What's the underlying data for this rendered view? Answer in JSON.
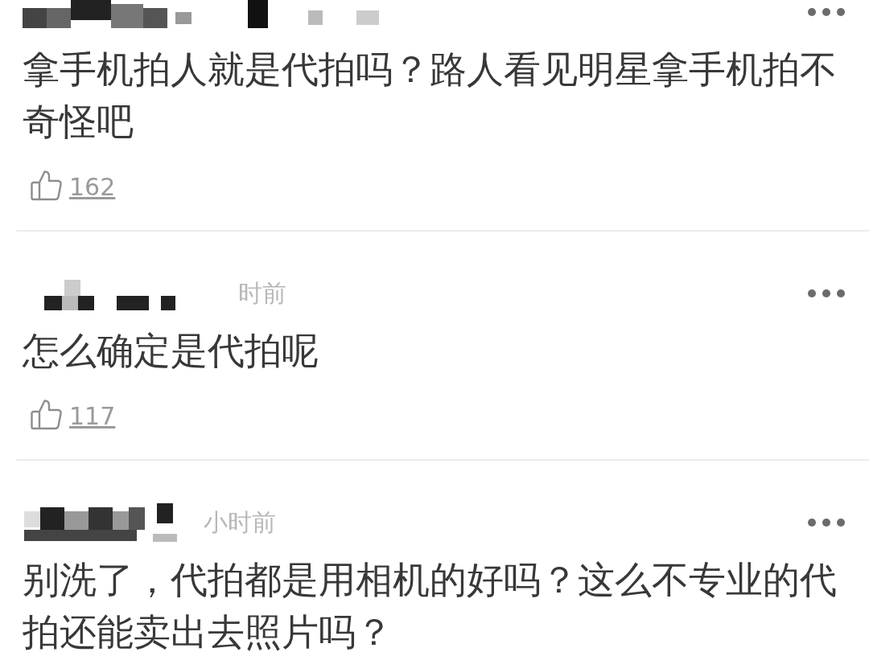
{
  "comments": [
    {
      "author_redacted": true,
      "text": "拿手机拍人就是代拍吗？路人看见明星拿手机拍不奇怪吧",
      "likes": "162"
    },
    {
      "author_redacted": true,
      "time": "时前",
      "text": "怎么确定是代拍呢",
      "likes": "117"
    },
    {
      "author_redacted": true,
      "time": "小时前",
      "text": "别洗了，代拍都是用相机的好吗？这么不专业的代拍还能卖出去照片吗？"
    }
  ]
}
